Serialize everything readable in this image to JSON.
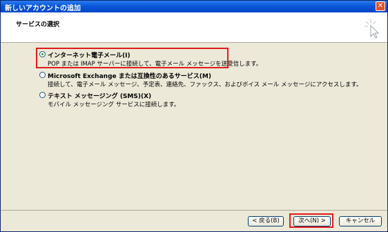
{
  "window": {
    "title": "新しいアカウントの追加",
    "close_icon": "close-icon"
  },
  "header": {
    "title": "サービスの選択",
    "icon": "wizard-sparkle-cursor-icon"
  },
  "options": [
    {
      "label": "インターネット電子メール(I)",
      "description": "POP または IMAP サーバーに接続して、電子メール メッセージを送受信します。",
      "selected": true
    },
    {
      "label": "Microsoft Exchange または互換性のあるサービス(M)",
      "description": "接続して、電子メール メッセージ、予定表、連絡先、ファックス、およびボイス メール メッセージにアクセスします。",
      "selected": false
    },
    {
      "label": "テキスト メッセージング (SMS)(X)",
      "description": "モバイル メッセージング サービスに接続します。",
      "selected": false
    }
  ],
  "buttons": {
    "back": "< 戻る(B)",
    "next": "次へ(N) >",
    "cancel": "キャンセル"
  },
  "colors": {
    "titlebar": "#0a57d8",
    "highlight": "#e21a1a",
    "radio_selected": "#2ea32e"
  }
}
